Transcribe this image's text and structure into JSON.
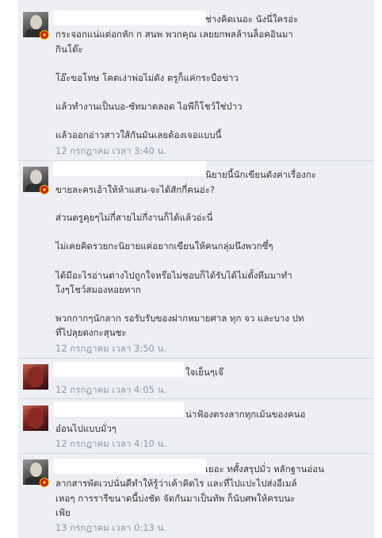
{
  "comments": [
    {
      "lines": [
        "ช่างคิดเนอะ นังนี่ใครอ่ะ",
        "กระจอกแน่แต่อกหัก ก สนพ พวกคุณ เลยยกพลล้านล็อคอินมา",
        "กินโต๊ะ",
        "โอ๊ะขอโทษ โคตเง่าพ่อไม่ดัง ตรูก็แค่กระบือข่าว",
        "แล้วทำงานเป็นบอ-ซัทมาตลอด ไอพีก็โชว์ใช่ป่าว",
        "แล้วออกอ่าวสาวใส้กันมันเลยต้องเจอแบบนี้"
      ],
      "timestamp": "12 กรกฎาคม เวลา 3:40 น."
    },
    {
      "lines": [
        "นิยายนี้นักเขียนดังค่าเรื่องกะ",
        "ขายละครเอ้าให้ห้าแสน-จะได้สักกี่คนอ่ะ?",
        "ส่วนตรูคุยๆไม่กี่สายไม่กี่งานก็ได้แล้วอ่ะนี่",
        "ไม่เคยคิดรวยกะนิยายแค่อยากเขียนให้คนกลุ่มนึงพวกซึ๋ๆ",
        "ได้มีอะไรอ่านต่างไปถูกใจหร๊อไม่ชอบก็ได้รับได้ไม่ตั้งทีมมาทำ",
        "โงๆโชว์สมองหอยทาก",
        "พวกกากๆนักลาก รอรับรับของฝากหมายศาล ทุก จว และบาง ปท",
        "ที่ไปลุยดงกะสุนชะ"
      ],
      "timestamp": "12 กรกฎาคม เวลา 3:50 น."
    },
    {
      "lines": [
        "ใจเย็นๆเจ๊"
      ],
      "timestamp": "12 กรกฎาคม เวลา 4:05 น."
    },
    {
      "lines": [
        "น่าฟ้องตรงลากทุกเม้นของคนอ",
        "อ๋อนไปแบบมั่วๆ"
      ],
      "timestamp": "12 กรกฎาคม เวลา 4:10 น."
    },
    {
      "lines": [
        "เยอะ ทศั้งสรุปมั่ว หลักฐานอ่อน",
        "ลากสารพัดเวปนั่นดีทำให้รู้ว่าเค้าคิดไร และที่ไปแปะไปส่งอีเมล์",
        "เหอๆ การรารีขนาดนี้บ่งชัด จัดกันมาเป็นทัพ ก็นับศพให้ครบนะ",
        "เฟ้ย"
      ],
      "timestamp": "13 กรกฎาคม เวลา 0:13 น."
    }
  ]
}
